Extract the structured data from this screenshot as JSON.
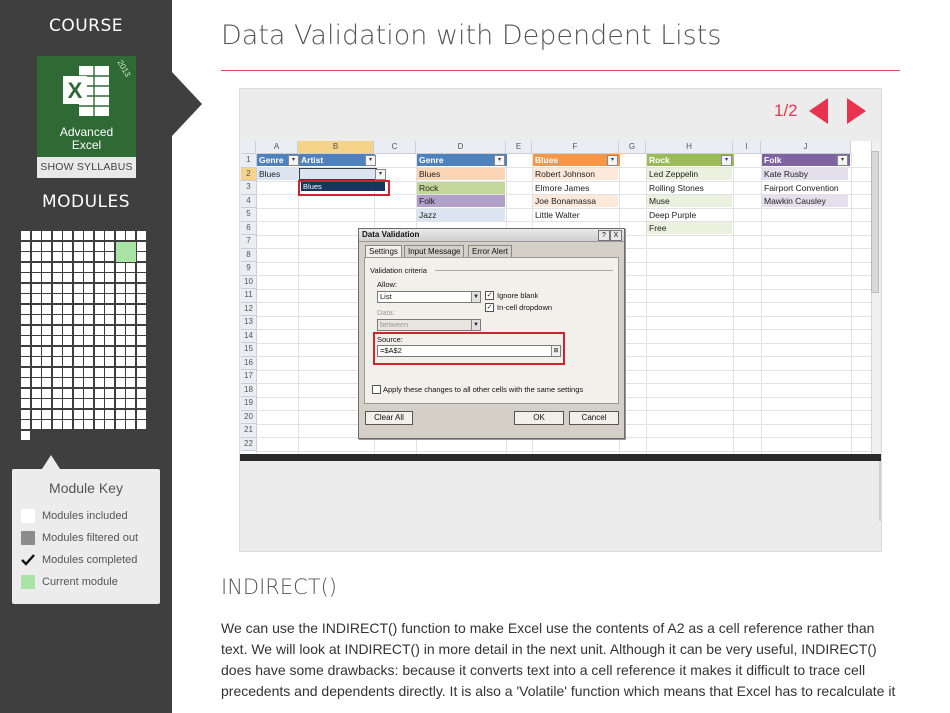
{
  "sidebar": {
    "course_heading": "COURSE",
    "course_logo_letter": "X",
    "course_year": "2013",
    "course_name_line1": "Advanced",
    "course_name_line2": "Excel",
    "syllabus_button": "SHOW SYLLABUS",
    "modules_heading": "MODULES",
    "module_key": {
      "title": "Module Key",
      "items": [
        {
          "label": "Modules included",
          "color": "#ffffff"
        },
        {
          "label": "Modules filtered out",
          "color": "#8c8c8c"
        },
        {
          "label": "Modules completed",
          "icon": "check-icon"
        },
        {
          "label": "Current module",
          "color": "#a9e3a5"
        }
      ]
    }
  },
  "main": {
    "title": "Data Validation with Dependent Lists",
    "accent_color": "#e04b5f",
    "slide": {
      "counter": "1/2",
      "prev_icon": "chevron-left-icon",
      "next_icon": "chevron-right-icon",
      "spreadsheet": {
        "columns": [
          "A",
          "B",
          "C",
          "D",
          "E",
          "F",
          "G",
          "H",
          "I",
          "J"
        ],
        "rows": [
          "1",
          "2",
          "3",
          "4",
          "5",
          "6",
          "7",
          "8",
          "9",
          "10",
          "11",
          "12",
          "13",
          "14",
          "15",
          "16",
          "17",
          "18",
          "19",
          "20",
          "21",
          "22"
        ],
        "a_header": "Genre",
        "a_value": "Blues",
        "b_header": "Artist",
        "dropdown_item": "Blues",
        "genre_header": "Genre",
        "genre_list": [
          "Blues",
          "Rock",
          "Folk",
          "Jazz"
        ],
        "blues_header": "Blues",
        "blues_list": [
          "Robert Johnson",
          "Elmore James",
          "Joe Bonamassa",
          "Little Walter"
        ],
        "rock_header": "Rock",
        "rock_list": [
          "Led Zeppelin",
          "Rolling Stones",
          "Muse",
          "Deep Purple",
          "Free"
        ],
        "folk_header": "Folk",
        "folk_list": [
          "Kate Rusby",
          "Fairport Convention",
          "Mawkin Causley"
        ]
      },
      "dialog": {
        "title": "Data Validation",
        "help_btn": "?",
        "close_btn": "X",
        "tabs": [
          "Settings",
          "Input Message",
          "Error Alert"
        ],
        "group_label": "Validation criteria",
        "allow_label": "Allow:",
        "allow_value": "List",
        "ignore_blank": "Ignore blank",
        "in_cell_dropdown": "In-cell dropdown",
        "data_label": "Data:",
        "data_value": "between",
        "source_label": "Source:",
        "source_value": "=$A$2",
        "apply_all": "Apply these changes to all other cells with the same settings",
        "clear_all": "Clear All",
        "ok": "OK",
        "cancel": "Cancel"
      }
    },
    "section_heading": "INDIRECT()",
    "body_text": "We can use the INDIRECT() function to make Excel use the contents of A2 as a cell reference rather than text. We will look at INDIRECT() in more detail in the next unit. Although it can be very useful, INDIRECT() does have some drawbacks: because it converts text into a cell reference it makes it difficult to trace cell precedents and dependents directly. It is also a 'Volatile' function which means that Excel has to recalculate it"
  }
}
